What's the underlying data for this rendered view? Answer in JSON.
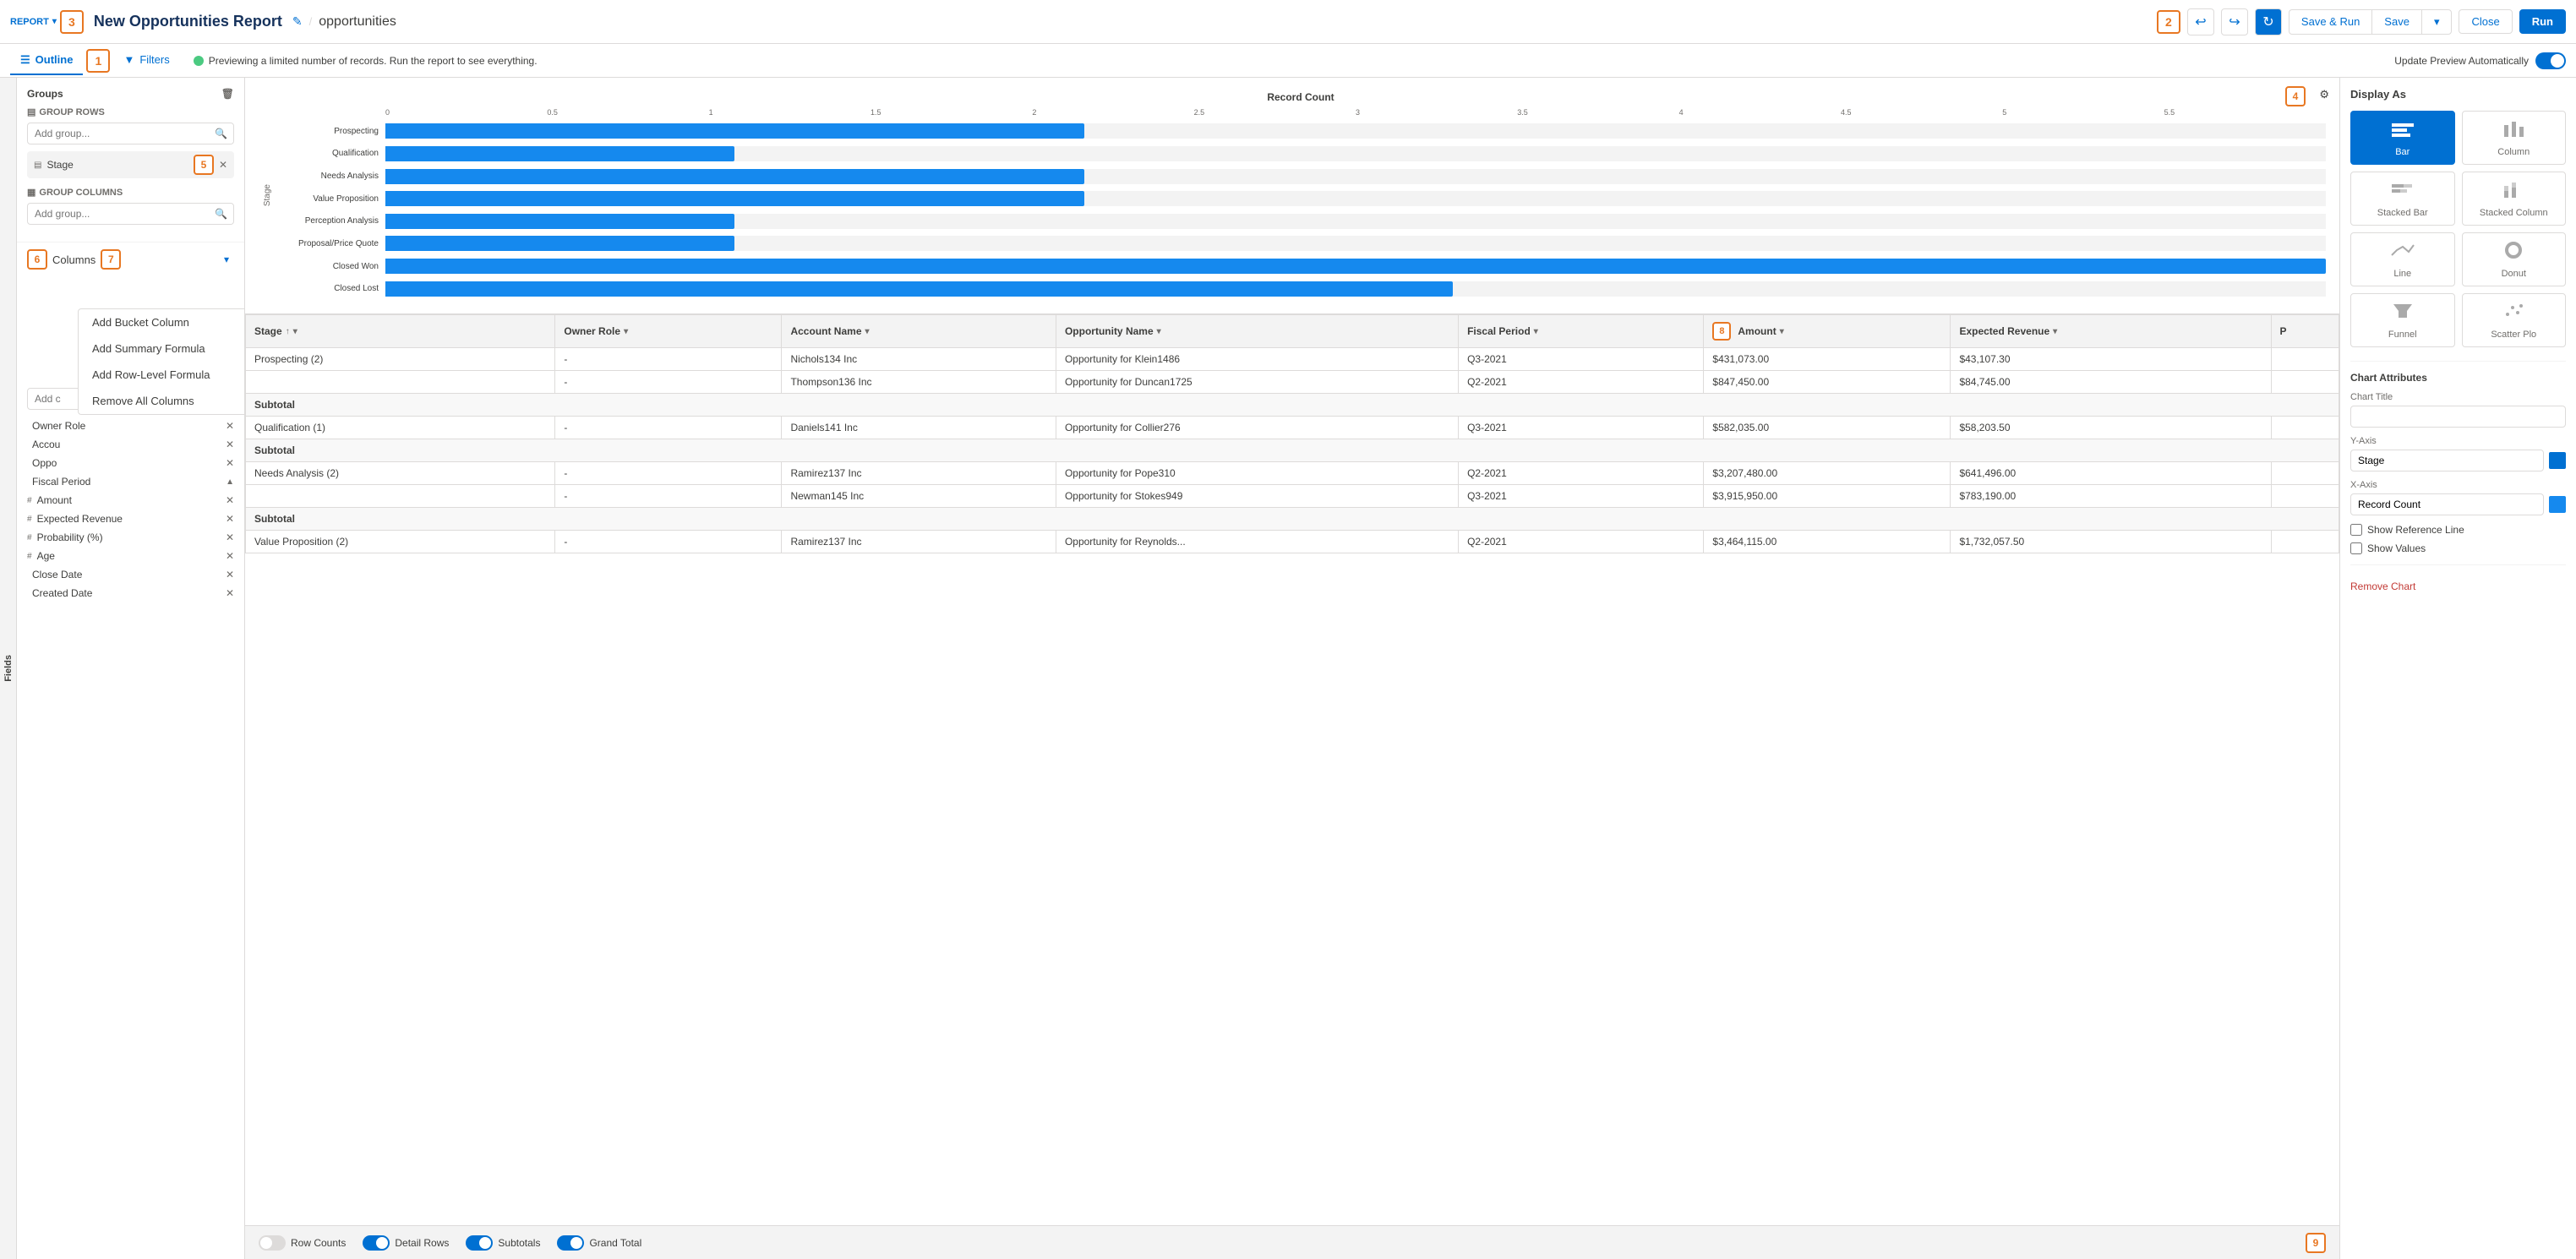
{
  "header": {
    "report_label": "REPORT",
    "title": "New Opportunities Report",
    "breadcrumb": "opportunities",
    "save_run_label": "Save & Run",
    "save_label": "Save",
    "close_label": "Close",
    "run_label": "Run"
  },
  "annotations": {
    "n1": "1",
    "n2": "2",
    "n3": "3",
    "n4": "4",
    "n5": "5",
    "n6": "6",
    "n7": "7",
    "n8": "8",
    "n9": "9"
  },
  "sub_header": {
    "outline_tab": "Outline",
    "filters_tab": "Filters",
    "preview_msg": "Previewing a limited number of records. Run the report to see everything.",
    "auto_preview": "Update Preview Automatically"
  },
  "left_panel": {
    "groups_title": "Groups",
    "group_rows_label": "GROUP ROWS",
    "group_cols_label": "GROUP COLUMNS",
    "add_group_placeholder": "Add group...",
    "stage_pill": "Stage",
    "columns_title": "Columns",
    "add_column_placeholder": "Add c",
    "columns": [
      {
        "label": "Owner Role",
        "type": ""
      },
      {
        "label": "Accou",
        "type": ""
      },
      {
        "label": "Oppo",
        "type": ""
      },
      {
        "label": "Fiscal Period",
        "type": ""
      },
      {
        "label": "Amount",
        "type": "#"
      },
      {
        "label": "Expected Revenue",
        "type": "#"
      },
      {
        "label": "Probability (%)",
        "type": "#"
      },
      {
        "label": "Age",
        "type": "#"
      },
      {
        "label": "Close Date",
        "type": ""
      },
      {
        "label": "Created Date",
        "type": ""
      }
    ],
    "dropdown_items": [
      "Add Bucket Column",
      "Add Summary Formula",
      "Add Row-Level Formula",
      "Remove All Columns"
    ]
  },
  "chart": {
    "title": "Record Count",
    "x_labels": [
      "0",
      "0.5",
      "1",
      "1.5",
      "2",
      "2.5",
      "3",
      "3.5",
      "4",
      "4.5",
      "5",
      "5.5"
    ],
    "y_label": "Stage",
    "bars": [
      {
        "label": "Prospecting",
        "value": 2,
        "width_pct": 36
      },
      {
        "label": "Qualification",
        "value": 1,
        "width_pct": 18
      },
      {
        "label": "Needs Analysis",
        "value": 2,
        "width_pct": 36
      },
      {
        "label": "Value Proposition",
        "value": 2,
        "width_pct": 36
      },
      {
        "label": "Perception Analysis",
        "value": 1,
        "width_pct": 18
      },
      {
        "label": "Proposal/Price Quote",
        "value": 1,
        "width_pct": 18
      },
      {
        "label": "Closed Won",
        "value": 5.5,
        "width_pct": 100
      },
      {
        "label": "Closed Lost",
        "value": 3,
        "width_pct": 55
      }
    ]
  },
  "table": {
    "columns": [
      "Stage",
      "Owner Role",
      "Account Name",
      "Opportunity Name",
      "Fiscal Period",
      "Amount",
      "Expected Revenue",
      "P"
    ],
    "rows": [
      {
        "stage": "Prospecting (2)",
        "owner": "-",
        "account": "Nichols134 Inc",
        "opportunity": "Opportunity for Klein1486",
        "fiscal": "Q3-2021",
        "amount": "$431,073.00",
        "expected": "$43,107.30",
        "p": "",
        "type": "data"
      },
      {
        "stage": "",
        "owner": "-",
        "account": "Thompson136 Inc",
        "opportunity": "Opportunity for Duncan1725",
        "fiscal": "Q2-2021",
        "amount": "$847,450.00",
        "expected": "$84,745.00",
        "p": "",
        "type": "data"
      },
      {
        "stage": "Subtotal",
        "owner": "",
        "account": "",
        "opportunity": "",
        "fiscal": "",
        "amount": "",
        "expected": "",
        "p": "",
        "type": "subtotal"
      },
      {
        "stage": "Qualification (1)",
        "owner": "-",
        "account": "Daniels141 Inc",
        "opportunity": "Opportunity for Collier276",
        "fiscal": "Q3-2021",
        "amount": "$582,035.00",
        "expected": "$58,203.50",
        "p": "",
        "type": "data"
      },
      {
        "stage": "Subtotal",
        "owner": "",
        "account": "",
        "opportunity": "",
        "fiscal": "",
        "amount": "",
        "expected": "",
        "p": "",
        "type": "subtotal"
      },
      {
        "stage": "Needs Analysis (2)",
        "owner": "-",
        "account": "Ramirez137 Inc",
        "opportunity": "Opportunity for Pope310",
        "fiscal": "Q2-2021",
        "amount": "$3,207,480.00",
        "expected": "$641,496.00",
        "p": "",
        "type": "data"
      },
      {
        "stage": "",
        "owner": "-",
        "account": "Newman145 Inc",
        "opportunity": "Opportunity for Stokes949",
        "fiscal": "Q3-2021",
        "amount": "$3,915,950.00",
        "expected": "$783,190.00",
        "p": "",
        "type": "data"
      },
      {
        "stage": "Subtotal",
        "owner": "",
        "account": "",
        "opportunity": "",
        "fiscal": "",
        "amount": "",
        "expected": "",
        "p": "",
        "type": "subtotal"
      },
      {
        "stage": "Value Proposition (2)",
        "owner": "-",
        "account": "Ramirez137 Inc",
        "opportunity": "Opportunity for Reynolds...",
        "fiscal": "Q2-2021",
        "amount": "$3,464,115.00",
        "expected": "$1,732,057.50",
        "p": "",
        "type": "data"
      }
    ]
  },
  "bottom_toolbar": {
    "row_counts_label": "Row Counts",
    "detail_rows_label": "Detail Rows",
    "subtotals_label": "Subtotals",
    "grand_total_label": "Grand Total",
    "row_counts_on": false,
    "detail_rows_on": true,
    "subtotals_on": true,
    "grand_total_on": true
  },
  "right_panel": {
    "display_as_title": "Display As",
    "options": [
      {
        "label": "Bar",
        "active": true,
        "icon": "▬"
      },
      {
        "label": "Column",
        "active": false,
        "icon": "▮"
      },
      {
        "label": "Stacked Bar",
        "active": false,
        "icon": "≡"
      },
      {
        "label": "Stacked Column",
        "active": false,
        "icon": "⧉"
      },
      {
        "label": "Line",
        "active": false,
        "icon": "∿"
      },
      {
        "label": "Donut",
        "active": false,
        "icon": "◎"
      },
      {
        "label": "Funnel",
        "active": false,
        "icon": "⧖"
      },
      {
        "label": "Scatter Plo",
        "active": false,
        "icon": "⁘"
      }
    ],
    "chart_attributes_title": "Chart Attributes",
    "chart_title_label": "Chart Title",
    "chart_title_value": "",
    "y_axis_label": "Y-Axis",
    "y_axis_value": "Stage",
    "y_axis_color": "#0070d2",
    "x_axis_label": "X-Axis",
    "x_axis_value": "Record Count",
    "x_axis_color": "#1589ee",
    "show_reference_line_label": "Show Reference Line",
    "show_values_label": "Show Values",
    "remove_chart_label": "Remove Chart"
  }
}
